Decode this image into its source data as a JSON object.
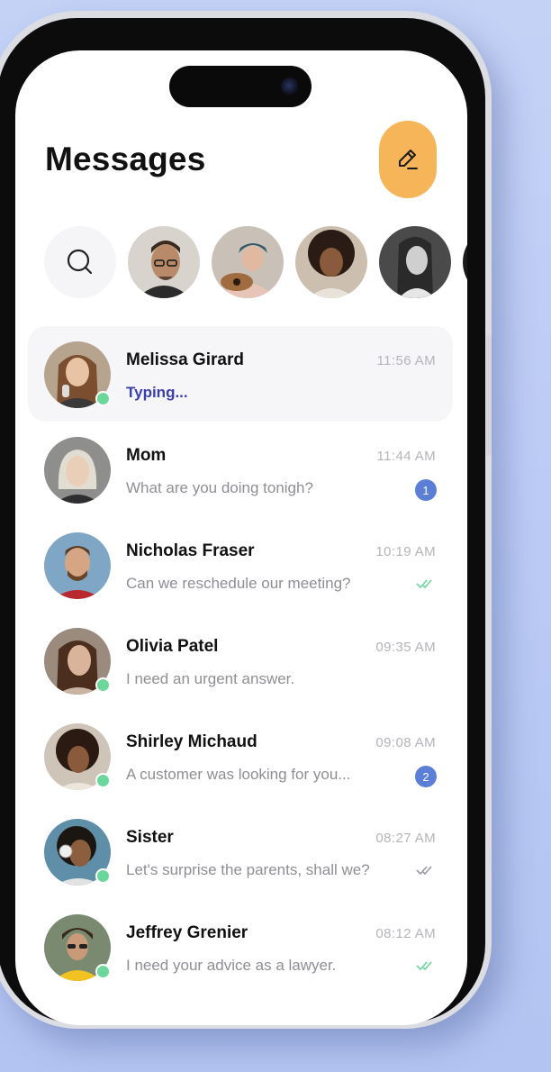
{
  "header": {
    "title": "Messages",
    "compose_icon": "pencil-icon",
    "search_icon": "search-icon"
  },
  "stories": [
    {
      "name": "story-1"
    },
    {
      "name": "story-2"
    },
    {
      "name": "story-3"
    },
    {
      "name": "story-4"
    }
  ],
  "conversations": [
    {
      "name": "Melissa Girard",
      "time": "11:56 AM",
      "preview": "Typing...",
      "typing": true,
      "online": true
    },
    {
      "name": "Mom",
      "time": "11:44 AM",
      "preview": "What are you doing tonigh?",
      "unread": "1",
      "online": false
    },
    {
      "name": "Nicholas Fraser",
      "time": "10:19 AM",
      "preview": "Can we reschedule our meeting?",
      "status": "read",
      "online": false
    },
    {
      "name": "Olivia Patel",
      "time": "09:35 AM",
      "preview": "I need an urgent answer.",
      "online": true
    },
    {
      "name": "Shirley Michaud",
      "time": "09:08 AM",
      "preview": "A customer was looking for you...",
      "unread": "2",
      "online": true
    },
    {
      "name": "Sister",
      "time": "08:27 AM",
      "preview": "Let's surprise the parents, shall we?",
      "status": "delivered",
      "online": true
    },
    {
      "name": "Jeffrey Grenier",
      "time": "08:12 AM",
      "preview": "I need your advice as a lawyer.",
      "status": "read",
      "online": true
    }
  ],
  "colors": {
    "accent": "#f5b558",
    "typing": "#3a3fae",
    "badge": "#5b7fd6",
    "online": "#6bd79a",
    "read_check": "#6bd79a",
    "delivered_check": "#9a9aa2"
  }
}
